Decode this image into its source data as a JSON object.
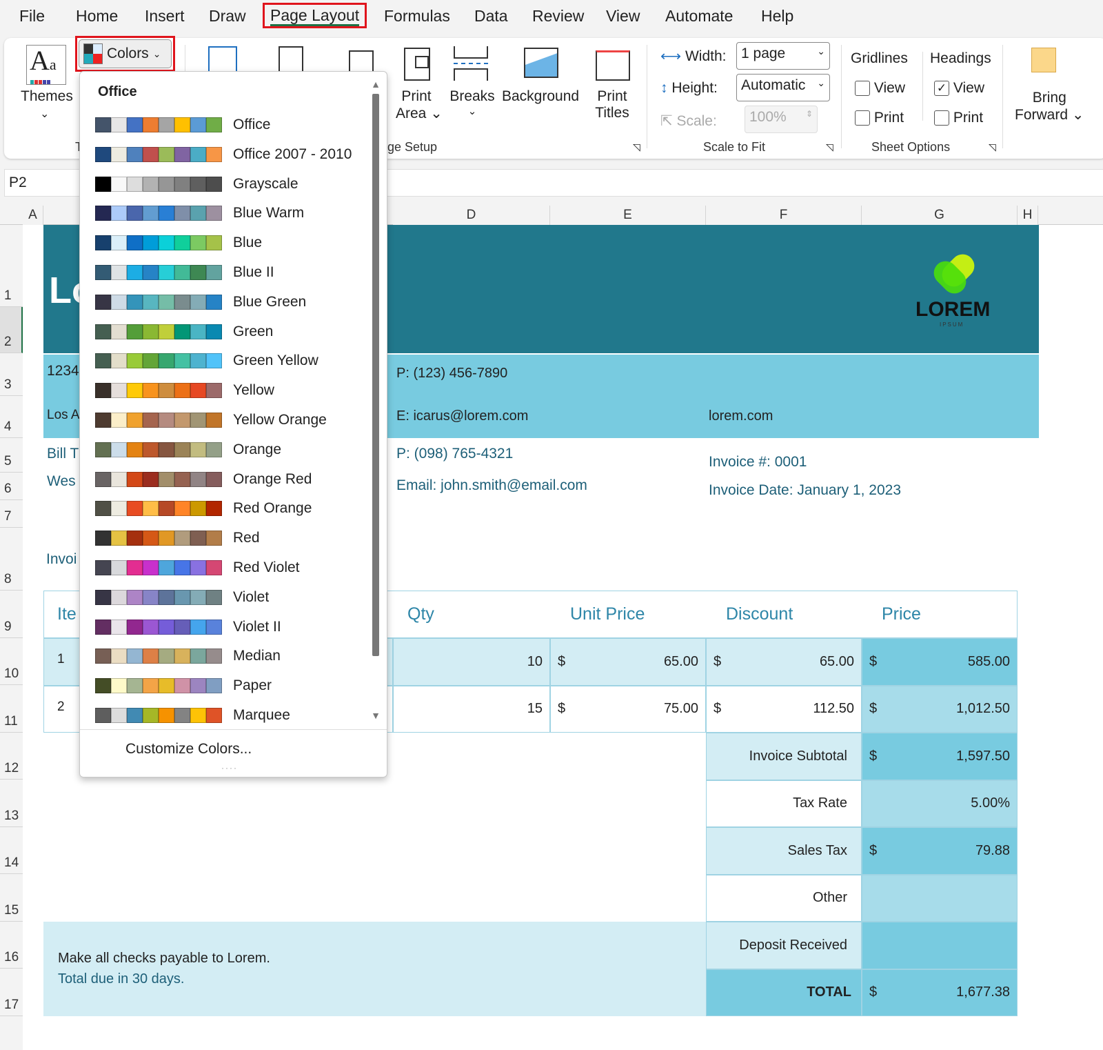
{
  "menu": {
    "tabs": [
      "File",
      "Home",
      "Insert",
      "Draw",
      "Page Layout",
      "Formulas",
      "Data",
      "Review",
      "View",
      "Automate",
      "Help"
    ],
    "active": "Page Layout"
  },
  "ribbon": {
    "themes": "Themes",
    "colors": "Colors",
    "print_area_1": "Print",
    "print_area_2": "Area",
    "breaks": "Breaks",
    "background": "Background",
    "print_titles_1": "Print",
    "print_titles_2": "Titles",
    "page_setup_group": "ge Setup",
    "themes_group_fragment": "T",
    "width_label": "Width:",
    "width_value": "1 page",
    "height_label": "Height:",
    "height_value": "Automatic",
    "scale_label": "Scale:",
    "scale_value": "100%",
    "scale_group": "Scale to Fit",
    "gridlines": "Gridlines",
    "headings": "Headings",
    "view": "View",
    "print": "Print",
    "gridlines_view": false,
    "gridlines_print": false,
    "headings_view": true,
    "headings_print": false,
    "sheet_options_group": "Sheet Options",
    "bring_forward_1": "Bring",
    "bring_forward_2": "Forward"
  },
  "name_box": "P2",
  "columns": [
    "A",
    "D",
    "E",
    "F",
    "G",
    "H"
  ],
  "rows": [
    "1",
    "2",
    "3",
    "4",
    "5",
    "6",
    "7",
    "8",
    "9",
    "10",
    "11",
    "12",
    "13",
    "14",
    "15",
    "16",
    "17"
  ],
  "colors_dropdown": {
    "section": "Office",
    "customize": "Customize Colors...",
    "palettes": [
      {
        "name": "Office",
        "colors": [
          "#44546A",
          "#E7E6E6",
          "#4472C4",
          "#ED7D31",
          "#A5A5A5",
          "#FFC000",
          "#5B9BD5",
          "#70AD47"
        ]
      },
      {
        "name": "Office 2007 - 2010",
        "colors": [
          "#1F497D",
          "#EEECE1",
          "#4F81BD",
          "#C0504D",
          "#9BBB59",
          "#8064A2",
          "#4BACC6",
          "#F79646"
        ]
      },
      {
        "name": "Grayscale",
        "colors": [
          "#000000",
          "#F8F8F8",
          "#DDDDDD",
          "#B2B2B2",
          "#969696",
          "#808080",
          "#5F5F5F",
          "#4D4D4D"
        ]
      },
      {
        "name": "Blue Warm",
        "colors": [
          "#242852",
          "#ACCBF9",
          "#4A66AC",
          "#629DD1",
          "#297FD5",
          "#7F8FA9",
          "#5AA2AE",
          "#9D90A0"
        ]
      },
      {
        "name": "Blue",
        "colors": [
          "#17406D",
          "#DBEFF9",
          "#0F6FC6",
          "#009DD9",
          "#0BD0D9",
          "#10CF9B",
          "#7CCA62",
          "#A5C249"
        ]
      },
      {
        "name": "Blue II",
        "colors": [
          "#335B74",
          "#DFE3E5",
          "#1CADE4",
          "#2683C6",
          "#27CED7",
          "#42BA97",
          "#3E8853",
          "#62A39F"
        ]
      },
      {
        "name": "Blue Green",
        "colors": [
          "#373545",
          "#CEDBE6",
          "#3494BA",
          "#58B6C0",
          "#75BDA7",
          "#7A8C8E",
          "#84ACB6",
          "#2683C6"
        ]
      },
      {
        "name": "Green",
        "colors": [
          "#455F51",
          "#E3DED1",
          "#549E39",
          "#8AB833",
          "#C0CF3A",
          "#029676",
          "#4AB5C4",
          "#0989B1"
        ]
      },
      {
        "name": "Green Yellow",
        "colors": [
          "#455F51",
          "#E3DECA",
          "#99CB38",
          "#63A537",
          "#37A76F",
          "#44C1A3",
          "#4EB3CF",
          "#51C3F9"
        ]
      },
      {
        "name": "Yellow",
        "colors": [
          "#39302A",
          "#E5DEDB",
          "#FFCA08",
          "#F8931D",
          "#CE8D3E",
          "#EC7016",
          "#E64823",
          "#9C6A6A"
        ]
      },
      {
        "name": "Yellow Orange",
        "colors": [
          "#4E3B30",
          "#FBEEC9",
          "#F0A22E",
          "#A5644E",
          "#B58B80",
          "#C3986D",
          "#A19574",
          "#C17529"
        ]
      },
      {
        "name": "Orange",
        "colors": [
          "#637052",
          "#CCDDEA",
          "#E48312",
          "#BD582C",
          "#865640",
          "#9B8357",
          "#C2BC80",
          "#94A088"
        ]
      },
      {
        "name": "Orange Red",
        "colors": [
          "#696464",
          "#E9E5DC",
          "#D34817",
          "#9B2D1F",
          "#A28E6A",
          "#956251",
          "#918485",
          "#855D5D"
        ]
      },
      {
        "name": "Red Orange",
        "colors": [
          "#505046",
          "#EEECE1",
          "#E84C22",
          "#FFBD47",
          "#B64926",
          "#FF8427",
          "#CC9900",
          "#B22600"
        ]
      },
      {
        "name": "Red",
        "colors": [
          "#323232",
          "#E5C243",
          "#A5300F",
          "#D55816",
          "#E19825",
          "#B19C7D",
          "#7F5F52",
          "#B27D49"
        ]
      },
      {
        "name": "Red Violet",
        "colors": [
          "#454551",
          "#D8D9DC",
          "#E32D91",
          "#C830CC",
          "#4EA6DC",
          "#4775E7",
          "#8971E1",
          "#D54773"
        ]
      },
      {
        "name": "Violet",
        "colors": [
          "#373545",
          "#DCD8DC",
          "#AD84C6",
          "#8784C7",
          "#5D739A",
          "#6997AF",
          "#84ACB6",
          "#6F8183"
        ]
      },
      {
        "name": "Violet II",
        "colors": [
          "#632E62",
          "#EAE5EB",
          "#92278F",
          "#9B57D3",
          "#755DD9",
          "#665EB8",
          "#45A5ED",
          "#5982DB"
        ]
      },
      {
        "name": "Median",
        "colors": [
          "#775F55",
          "#EBDDC3",
          "#94B6D2",
          "#DD8047",
          "#A5AB81",
          "#D8B25C",
          "#7BA79D",
          "#968C8C"
        ]
      },
      {
        "name": "Paper",
        "colors": [
          "#444D26",
          "#FEFAC9",
          "#A5B592",
          "#F3A447",
          "#E7BC29",
          "#D092A7",
          "#9C85C0",
          "#809EC2"
        ]
      },
      {
        "name": "Marquee",
        "colors": [
          "#5E5E5E",
          "#DDDDDD",
          "#418AB3",
          "#A6B727",
          "#F69200",
          "#838383",
          "#FEC306",
          "#DF5327"
        ]
      }
    ]
  },
  "invoice": {
    "title_fragment": "Lo",
    "logo_text": "LOREM",
    "logo_sub": "IPSUM",
    "address1_fragment": "1234",
    "address2_fragment": "Los A",
    "phone": "P: (123) 456-7890",
    "email": "E: icarus@lorem.com",
    "website": "lorem.com",
    "bill_to_fragment": "Bill T",
    "bill_addr_fragment": "Wes",
    "client_phone": "P: (098) 765-4321",
    "client_email": "Email: john.smith@email.com",
    "invoice_no": "Invoice #: 0001",
    "invoice_date": "Invoice Date: January 1, 2023",
    "invoice_label_fragment": "Invoi",
    "headers": {
      "item_fragment": "Ite",
      "qty": "Qty",
      "unit_price": "Unit Price",
      "discount": "Discount",
      "price": "Price"
    },
    "items": [
      {
        "no": "1",
        "qty": "10",
        "unit_cur": "$",
        "unit": "65.00",
        "disc_cur": "$",
        "disc": "65.00",
        "price_cur": "$",
        "price": "585.00"
      },
      {
        "no": "2",
        "qty": "15",
        "unit_cur": "$",
        "unit": "75.00",
        "disc_cur": "$",
        "disc": "112.50",
        "price_cur": "$",
        "price": "1,012.50"
      }
    ],
    "totals": [
      {
        "label": "Invoice Subtotal",
        "cur": "$",
        "value": "1,597.50"
      },
      {
        "label": "Tax Rate",
        "cur": "",
        "value": "5.00%"
      },
      {
        "label": "Sales Tax",
        "cur": "$",
        "value": "79.88"
      },
      {
        "label": "Other",
        "cur": "",
        "value": ""
      },
      {
        "label": "Deposit Received",
        "cur": "",
        "value": ""
      },
      {
        "label": "TOTAL",
        "cur": "$",
        "value": "1,677.38"
      }
    ],
    "note1": "Make all checks payable to Lorem.",
    "note2": "Total due in 30 days."
  },
  "colors": {
    "header_teal": "#21788C",
    "light_blue": "#78CBE0",
    "pale_blue": "#D3EDF4",
    "mid_blue": "#A7DCEA",
    "highlight_red": "#E0141C"
  }
}
